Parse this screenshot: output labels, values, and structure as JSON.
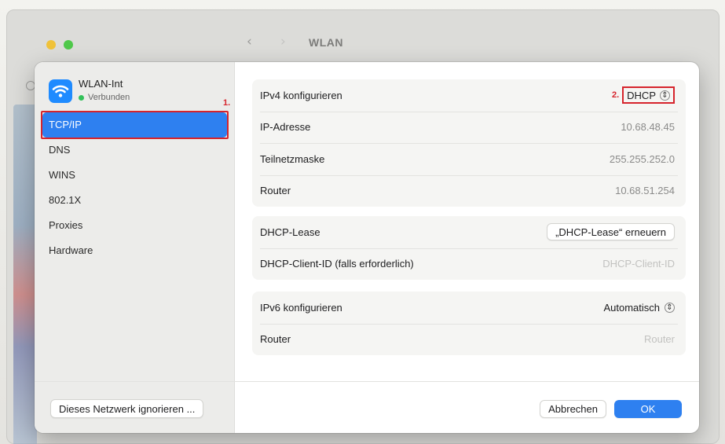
{
  "window": {
    "title": "WLAN",
    "back_glyph": "‹",
    "forward_glyph": "›"
  },
  "sidebar": {
    "network": {
      "name": "WLAN-Int",
      "status": "Verbunden",
      "status_color": "#33c15a",
      "icon": "wifi-icon"
    },
    "items": [
      {
        "label": "TCP/IP",
        "selected": true
      },
      {
        "label": "DNS"
      },
      {
        "label": "WINS"
      },
      {
        "label": "802.1X"
      },
      {
        "label": "Proxies"
      },
      {
        "label": "Hardware"
      }
    ],
    "step_marker": "1."
  },
  "tcpip": {
    "ipv4_configure": {
      "label": "IPv4 konfigurieren",
      "value": "DHCP",
      "step_marker": "2."
    },
    "ip_address": {
      "label": "IP-Adresse",
      "value": "10.68.48.45"
    },
    "subnet_mask": {
      "label": "Teilnetzmaske",
      "value": "255.255.252.0"
    },
    "router": {
      "label": "Router",
      "value": "10.68.51.254"
    },
    "dhcp_lease": {
      "label": "DHCP-Lease",
      "button": "„DHCP-Lease“ erneuern"
    },
    "dhcp_client_id": {
      "label": "DHCP-Client-ID (falls erforderlich)",
      "placeholder": "DHCP-Client-ID"
    },
    "ipv6_configure": {
      "label": "IPv6 konfigurieren",
      "value": "Automatisch"
    },
    "ipv6_router": {
      "label": "Router",
      "placeholder": "Router"
    }
  },
  "footer": {
    "ignore_button": "Dieses Netzwerk ignorieren ...",
    "cancel_button": "Abbrechen",
    "ok_button": "OK"
  },
  "colors": {
    "accent": "#2e80f0",
    "annotation_red": "#d6242c"
  }
}
